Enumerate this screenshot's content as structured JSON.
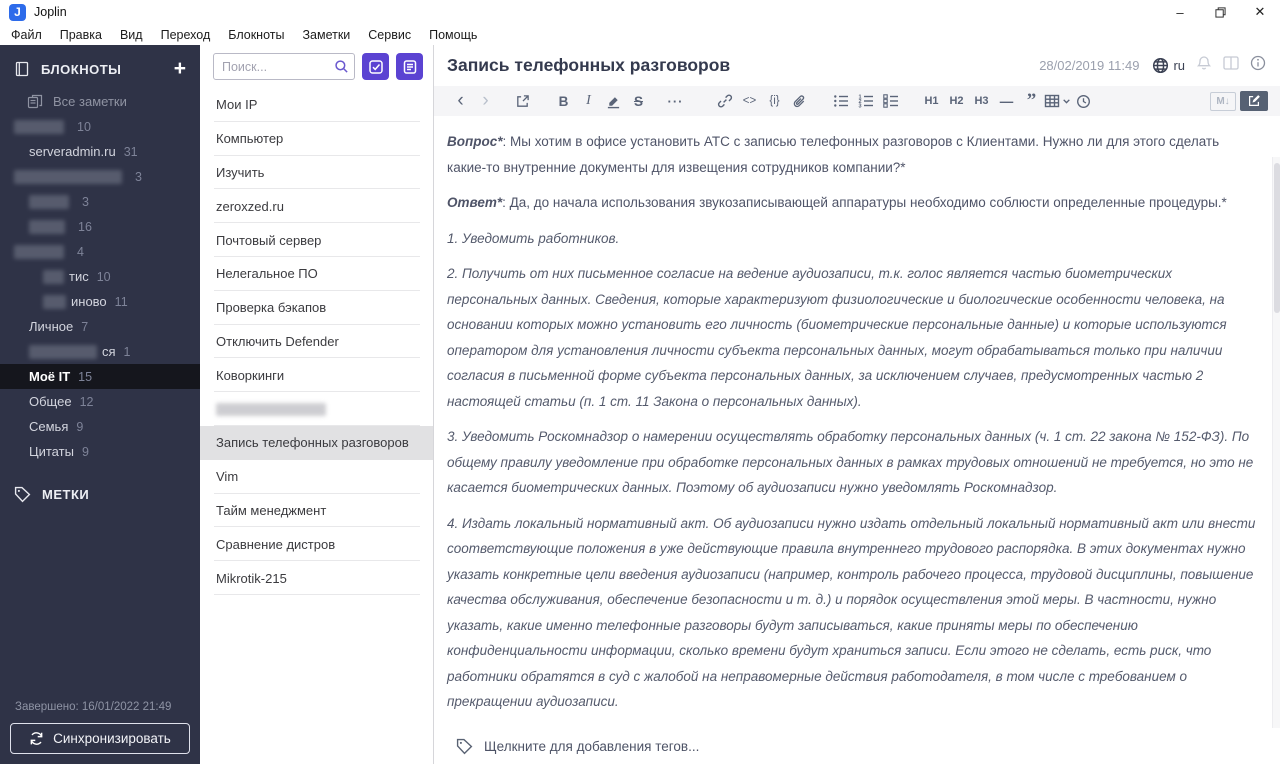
{
  "window": {
    "title": "Joplin",
    "minimize": "–",
    "close": "✕"
  },
  "menu": {
    "items": [
      "Файл",
      "Правка",
      "Вид",
      "Переход",
      "Блокноты",
      "Заметки",
      "Сервис",
      "Помощь"
    ]
  },
  "sidebar": {
    "notebooks_header": "БЛОКНОТЫ",
    "add_button": "+",
    "items": [
      {
        "label": "Все заметки",
        "type": "all"
      },
      {
        "redacted": true,
        "indent": 0,
        "rw": 50,
        "count": "10"
      },
      {
        "label": "serveradmin.ru",
        "indent": 1,
        "count": "31"
      },
      {
        "redacted": true,
        "indent": 0,
        "rw": 108,
        "count": "3"
      },
      {
        "redacted": true,
        "indent": 1,
        "rw": 40,
        "count": "3"
      },
      {
        "redacted": true,
        "indent": 1,
        "rw": 36,
        "count": "16"
      },
      {
        "redacted": true,
        "indent": 0,
        "rw": 50,
        "count": "4"
      },
      {
        "redacted": true,
        "indent": 2,
        "rw": 21,
        "suffix": "тис",
        "count": "10"
      },
      {
        "redacted": true,
        "indent": 2,
        "rw": 23,
        "suffix": "иново",
        "count": "11"
      },
      {
        "label": "Личное",
        "indent": 1,
        "count": "7"
      },
      {
        "redacted": true,
        "indent": 1,
        "rw": 68,
        "suffix": "ся",
        "count": "1"
      },
      {
        "label": "Моё IT",
        "indent": 1,
        "count": "15",
        "selected": true
      },
      {
        "label": "Общее",
        "indent": 1,
        "count": "12"
      },
      {
        "label": "Семья",
        "indent": 1,
        "count": "9"
      },
      {
        "label": "Цитаты",
        "indent": 1,
        "count": "9"
      }
    ],
    "tags_header": "МЕТКИ",
    "sync_status": "Завершено: 16/01/2022 21:49",
    "sync_button": "Синхронизировать"
  },
  "notelist": {
    "search_placeholder": "Поиск...",
    "notes": [
      {
        "title": "Мои IP"
      },
      {
        "title": "Компьютер"
      },
      {
        "title": "Изучить"
      },
      {
        "title": "zeroxzed.ru"
      },
      {
        "title": "Почтовый сервер"
      },
      {
        "title": "Нелегальное ПО"
      },
      {
        "title": "Проверка бэкапов"
      },
      {
        "title": "Отключить Defender"
      },
      {
        "title": "Коворкинги"
      },
      {
        "redacted": true
      },
      {
        "title": "Запись телефонных разговоров",
        "selected": true
      },
      {
        "title": "Vim"
      },
      {
        "title": "Тайм менеджмент"
      },
      {
        "title": "Сравнение дистров"
      },
      {
        "title": "Mikrotik-215"
      }
    ]
  },
  "editor": {
    "title": "Запись телефонных разговоров",
    "date": "28/02/2019 11:49",
    "locale": "ru",
    "toolbar": [
      "back",
      "forward",
      "external-link",
      "bold",
      "italic",
      "highlight",
      "strikethrough",
      "more",
      "link",
      "inline-code",
      "code-block",
      "attach",
      "bullet-list",
      "numbered-list",
      "checklist",
      "h1",
      "h2",
      "h3",
      "hr",
      "quote",
      "table",
      "insert-time"
    ],
    "toggle_markdown": "M↓",
    "content": [
      {
        "lead": "Вопрос*",
        "text": ": Мы хотим в офисе установить АТС с записью телефонных разговоров с Клиентами. Нужно ли для этого сделать какие-то внутренние документы для извещения сотрудников компании?*"
      },
      {
        "lead": "Ответ*",
        "text": ": Да, до начала использования звукозаписывающей аппаратуры необходимо соблюсти определенные процедуры.*"
      },
      {
        "italic": true,
        "text": "1. Уведомить работников."
      },
      {
        "italic": true,
        "text": "2. Получить от них письменное согласие на ведение аудиозаписи, т.к. голос является частью биометрических персональных данных. Сведения, которые характеризуют физиологические и биологические особенности человека, на основании которых можно установить его личность (биометрические персональные данные) и которые используются оператором для установления личности субъекта персональных данных, могут обрабатываться только при наличии согласия в письменной форме субъекта персональных данных, за исключением случаев, предусмотренных частью 2 настоящей статьи (п. 1 ст. 11 Закона о персональных данных)."
      },
      {
        "italic": true,
        "text": "3. Уведомить Роскомнадзор о намерении осуществлять обработку персональных данных (ч. 1 ст. 22 закона № 152-ФЗ). По общему правилу уведомление при обработке персональных данных в рамках трудовых отношений не требуется, но это не касается биометрических данных. Поэтому об аудиозаписи нужно уведомлять Роскомнадзор."
      },
      {
        "italic": true,
        "text": "4. Издать локальный нормативный акт. Об аудиозаписи нужно издать отдельный локальный нормативный акт или внести соответствующие положения в уже действующие правила внутреннего трудового распорядка. В этих документах нужно указать конкретные цели введения аудиозаписи (например, контроль рабочего процесса, трудовой дисциплины, повышение качества обслуживания, обеспечение безопасности и т. д.) и порядок осуществления этой меры. В частности, нужно указать, какие именно телефонные разговоры будут записываться, какие приняты меры по обеспечению конфиденциальности информации, сколько времени будут храниться записи. Если этого не сделать, есть риск, что работники обратятся в суд с жалобой на неправомерные действия работодателя, в том числе с требованием о прекращении аудиозаписи."
      }
    ],
    "tagbar": "Щелкните для добавления тегов..."
  },
  "colors": {
    "accent": "#5b43d2",
    "sidebar_bg": "#2f3347",
    "selected_note_bg": "#e1e1e3"
  }
}
